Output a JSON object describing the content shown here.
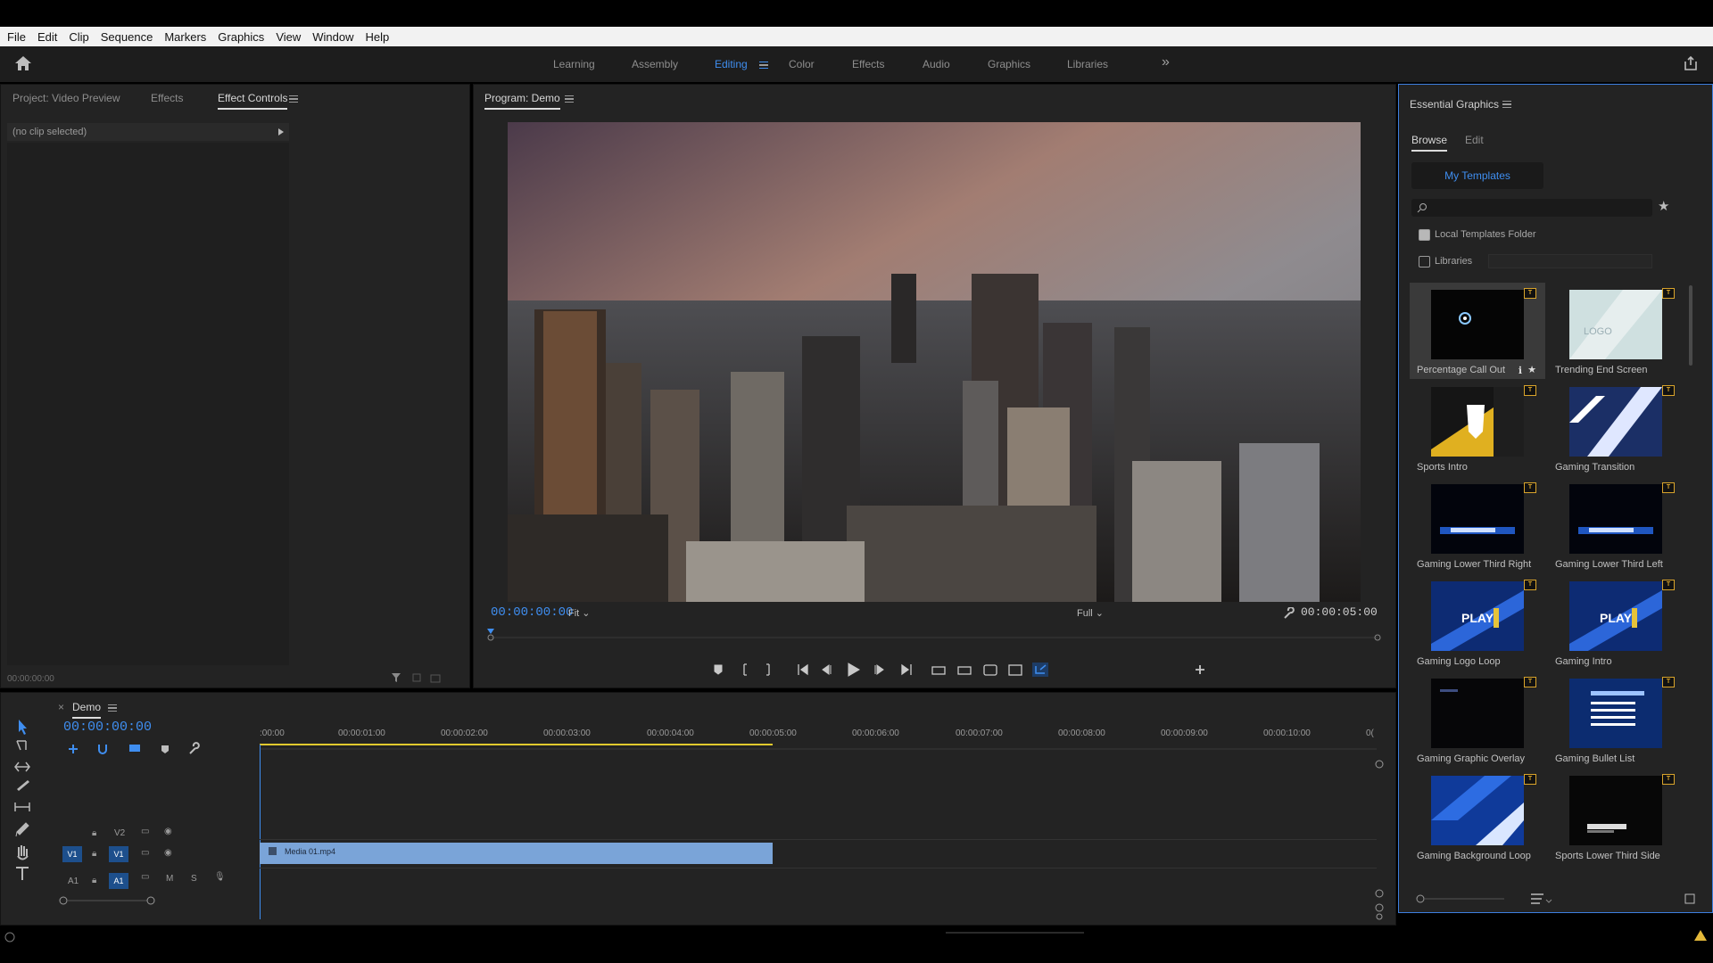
{
  "menu": [
    "File",
    "Edit",
    "Clip",
    "Sequence",
    "Markers",
    "Graphics",
    "View",
    "Window",
    "Help"
  ],
  "workspaces": [
    {
      "label": "Learning"
    },
    {
      "label": "Assembly"
    },
    {
      "label": "Editing",
      "active": true
    },
    {
      "label": "Color"
    },
    {
      "label": "Effects"
    },
    {
      "label": "Audio"
    },
    {
      "label": "Graphics"
    },
    {
      "label": "Libraries"
    }
  ],
  "left_panel": {
    "tabs": [
      "Project: Video Preview",
      "Effects",
      "Effect Controls"
    ],
    "active_tab": "Effect Controls",
    "no_clip": "(no clip selected)",
    "timecode": "00:00:00:00"
  },
  "program": {
    "title": "Program: Demo",
    "timecode": "00:00:00:00",
    "fit": "Fit",
    "quality": "Full",
    "duration": "00:00:05:00"
  },
  "timeline": {
    "title": "Demo",
    "timecode": "00:00:00:00",
    "ruler_labels": [
      ":00:00",
      "00:00:01:00",
      "00:00:02:00",
      "00:00:03:00",
      "00:00:04:00",
      "00:00:05:00",
      "00:00:06:00",
      "00:00:07:00",
      "00:00:08:00",
      "00:00:09:00",
      "00:00:10:00",
      "0("
    ],
    "tracks": {
      "v2": "V2",
      "v1_src": "V1",
      "v1": "V1",
      "a1_src": "A1",
      "a1": "A1",
      "mute": "M",
      "solo": "S"
    },
    "clip_name": "Media 01.mp4"
  },
  "essential_graphics": {
    "title": "Essential Graphics",
    "tabs": [
      "Browse",
      "Edit"
    ],
    "my_templates": "My Templates",
    "local_folder": "Local Templates Folder",
    "libraries": "Libraries",
    "templates": [
      {
        "name": "Percentage Call Out",
        "thumb": "percent"
      },
      {
        "name": "Trending End Screen",
        "thumb": "logo"
      },
      {
        "name": "Sports Intro",
        "thumb": "sports"
      },
      {
        "name": "Gaming Transition",
        "thumb": "diag"
      },
      {
        "name": "Gaming Lower Third Right",
        "thumb": "lower"
      },
      {
        "name": "Gaming Lower Third Left",
        "thumb": "lower"
      },
      {
        "name": "Gaming Logo Loop",
        "thumb": "play"
      },
      {
        "name": "Gaming Intro",
        "thumb": "play"
      },
      {
        "name": "Gaming Graphic Overlay",
        "thumb": "dark"
      },
      {
        "name": "Gaming Bullet List",
        "thumb": "list"
      },
      {
        "name": "Gaming Background Loop",
        "thumb": "bgloop"
      },
      {
        "name": "Sports Lower Third Side",
        "thumb": "sportslower"
      }
    ]
  },
  "colors": {
    "accent": "#3f8ef0",
    "panel": "#232323",
    "badge": "#d9a42b",
    "clip": "#7aa4d8"
  }
}
